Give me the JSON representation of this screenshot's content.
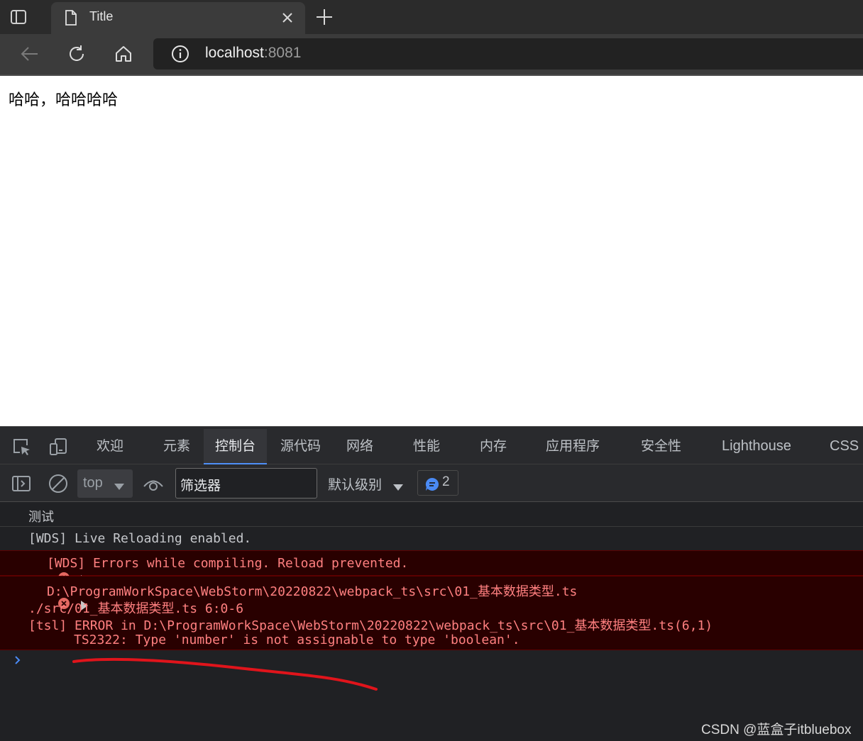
{
  "browser": {
    "tab": {
      "title": "Title"
    },
    "address": {
      "host": "localhost",
      "port": ":8081"
    }
  },
  "page": {
    "text": "哈哈，哈哈哈哈"
  },
  "devtools": {
    "tabs": [
      "欢迎",
      "元素",
      "控制台",
      "源代码",
      "网络",
      "性能",
      "内存",
      "应用程序",
      "安全性",
      "Lighthouse",
      "CSS 概"
    ],
    "active_tab": "控制台",
    "console_toolbar": {
      "context": "top",
      "filter_text": "筛选器",
      "level": "默认级别",
      "issues_count": "2"
    },
    "messages": {
      "log1": "测试",
      "log2": "[WDS] Live Reloading enabled.",
      "error1": "[WDS] Errors while compiling. Reload prevented.",
      "error2_lines": [
        "D:\\ProgramWorkSpace\\WebStorm\\20220822\\webpack_ts\\src\\01_基本数据类型.ts",
        "./src/01_基本数据类型.ts 6:0-6",
        "[tsl] ERROR in D:\\ProgramWorkSpace\\WebStorm\\20220822\\webpack_ts\\src\\01_基本数据类型.ts(6,1)",
        "TS2322: Type 'number' is not assignable to type 'boolean'."
      ]
    }
  },
  "watermark": "CSDN @蓝盒子itbluebox",
  "colors": {
    "tabstrip_bg": "#2b2b2b",
    "toolbar_bg": "#3b3b3b",
    "devtools_bg": "#202124",
    "error_bg": "#290000",
    "error_text": "#ff8080",
    "active_tab_underline": "#4f8ff7",
    "annotation_red": "#e0141b"
  },
  "icons": [
    "tab-actions-icon",
    "page-icon",
    "close-icon",
    "plus-icon",
    "back-arrow-icon",
    "refresh-icon",
    "home-icon",
    "info-icon",
    "inspect-icon",
    "device-toolbar-icon",
    "sidebar-icon",
    "clear-icon",
    "eye-icon",
    "chevron-down-icon",
    "message-icon",
    "error-icon",
    "expand-triangle-icon",
    "prompt-chevron-icon"
  ]
}
